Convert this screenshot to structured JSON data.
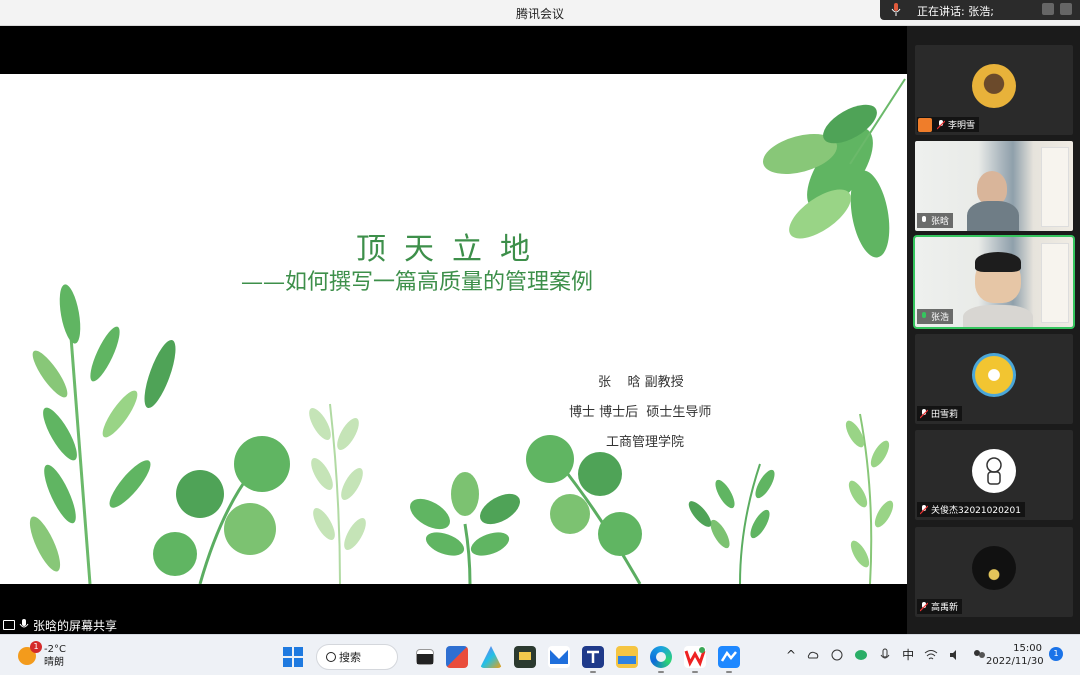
{
  "window": {
    "title": "腾讯会议"
  },
  "speaking": {
    "label": "正在讲话: 张浩;"
  },
  "slide": {
    "title": "顶天立地",
    "subtitle": "——如何撰写一篇高质量的管理案例",
    "author_name": "张    晗 副教授",
    "author_degrees": "博士 博士后  硕士生导师",
    "author_school": "工商管理学院"
  },
  "share": {
    "label": "张晗的屏幕共享"
  },
  "participants": [
    {
      "name": "李明雪",
      "video": false,
      "avatar_color": "#e8b23a"
    },
    {
      "name": "张晗",
      "video": true
    },
    {
      "name": "张浩",
      "video": true,
      "active": true
    },
    {
      "name": "田雪莉",
      "video": false,
      "avatar_color": "#f2c531"
    },
    {
      "name": "关俊杰32021020201",
      "video": false,
      "avatar_color": "#ffffff"
    },
    {
      "name": "高禹新",
      "video": false,
      "avatar_color": "#111111"
    }
  ],
  "taskbar": {
    "weather_temp": "-2°C",
    "weather_desc": "晴朗",
    "weather_badge": "1",
    "search_label": "搜索",
    "ime": "中",
    "time": "15:00",
    "date": "2022/11/30",
    "notifications": "1",
    "icons": [
      "windows-start-icon",
      "search-icon",
      "task-view-icon",
      "store-icon",
      "copilot-icon",
      "study-app-icon",
      "mail-icon",
      "tencent-meeting-icon",
      "file-explorer-icon",
      "edge-icon",
      "wps-icon",
      "lark-icon"
    ]
  }
}
